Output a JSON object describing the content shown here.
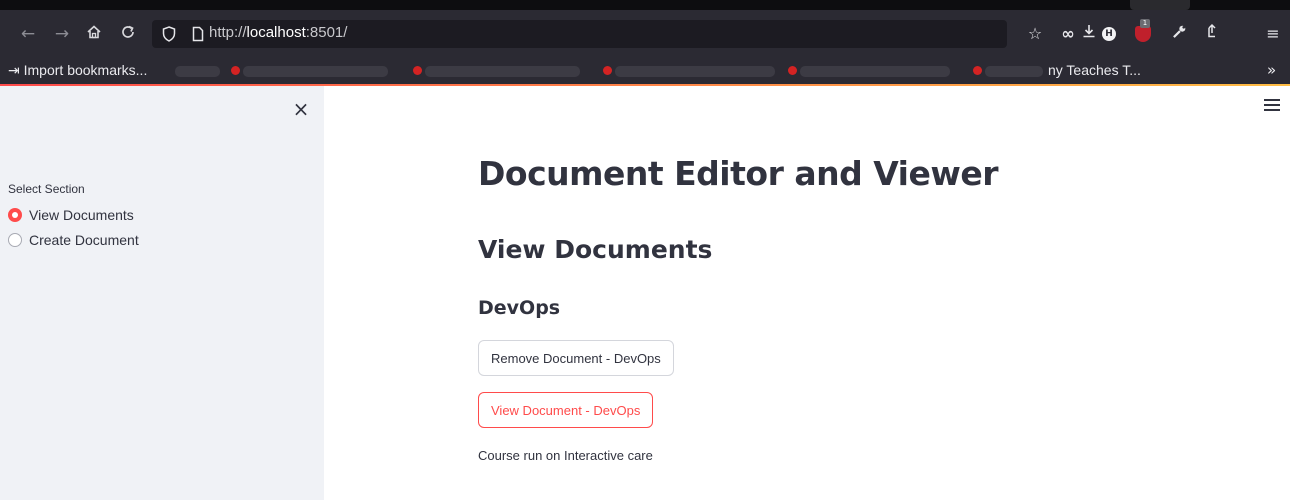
{
  "browser": {
    "url_prefix": "http://",
    "url_host": "localhost",
    "url_port": ":8501/",
    "bookmarks_import": "Import bookmarks...",
    "bookmark_last": "ny Teaches T...",
    "more_glyph": "»",
    "addon_badge_letter": "H",
    "ublock_count": "1"
  },
  "sidebar": {
    "close_glyph": "×",
    "radio_label": "Select Section",
    "options": [
      {
        "label": "View Documents",
        "selected": true
      },
      {
        "label": "Create Document",
        "selected": false
      }
    ]
  },
  "main": {
    "title": "Document Editor and Viewer",
    "section_heading": "View Documents",
    "document_name": "DevOps",
    "remove_button": "Remove Document - DevOps",
    "view_button": "View Document - DevOps",
    "description": "Course run on Interactive care"
  },
  "colors": {
    "accent": "#ff4b4b",
    "sidebar_bg": "#f0f2f6",
    "text": "#31333f",
    "browser_chrome": "#2b2a33"
  }
}
